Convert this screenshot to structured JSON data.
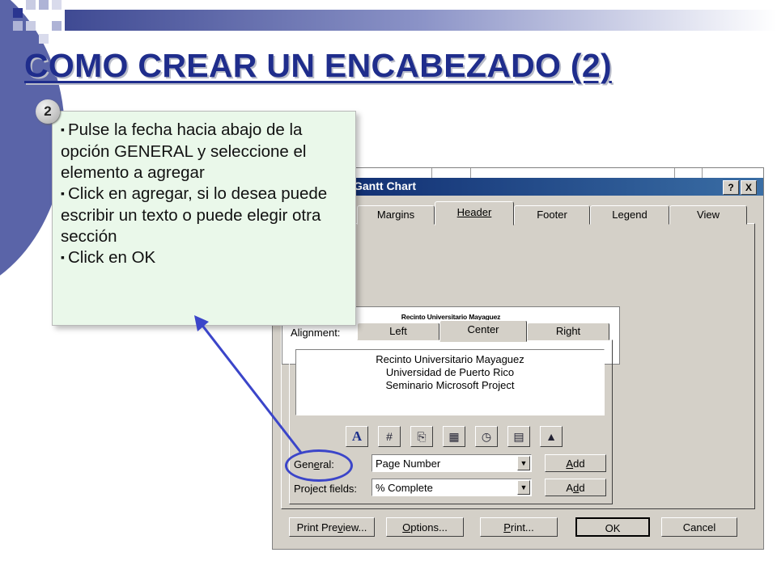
{
  "slide": {
    "title": "COMO CREAR UN ENCABEZADO (2)",
    "step_badge": "2",
    "instructions": [
      "Pulse la fecha hacia abajo de la opción GENERAL y seleccione el elemento a agregar",
      "Click en agregar, si lo desea puede escribir un texto o puede elegir otra sección",
      "Click en OK"
    ]
  },
  "dialog": {
    "title": "Gantt Chart",
    "help_button": "?",
    "close_button": "X",
    "tabs": [
      "Margins",
      "Header",
      "Footer",
      "Legend",
      "View"
    ],
    "active_tab": "Header",
    "preview_lines": [
      "Recinto Universitario Mayaguez",
      "Universidad de Puerto Rico",
      "Seminario Microsoft Project"
    ],
    "alignment_label": "Alignment:",
    "alignment_tabs": [
      "Left",
      "Center",
      "Right"
    ],
    "active_alignment": "Center",
    "header_text_lines": [
      "Recinto Universitario Mayaguez",
      "Universidad de Puerto Rico",
      "Seminario Microsoft Project"
    ],
    "toolbar_icons": [
      "font-icon",
      "page-number-icon",
      "total-pages-icon",
      "date-icon",
      "time-icon",
      "file-name-icon",
      "picture-icon"
    ],
    "general": {
      "label_pre": "Gen",
      "label_u": "e",
      "label_post": "ral:",
      "value": "Page Number",
      "add_pre": "",
      "add_u": "A",
      "add_post": "dd"
    },
    "project_fields": {
      "label": "Project fields:",
      "value": "% Complete",
      "add_pre": "A",
      "add_u": "d",
      "add_post": "d"
    },
    "buttons": {
      "print_preview_pre": "Print Pre",
      "print_preview_u": "v",
      "print_preview_post": "iew...",
      "options_pre": "",
      "options_u": "O",
      "options_post": "ptions...",
      "print_pre": "",
      "print_u": "P",
      "print_post": "rint...",
      "ok": "OK",
      "cancel": "Cancel"
    }
  },
  "colors": {
    "title": "#1f2d8c",
    "callout_bg": "#eaf8ea",
    "highlight": "#3b45c9",
    "dialog_bg": "#d4d0c8",
    "titlebar": "#0a246a"
  }
}
